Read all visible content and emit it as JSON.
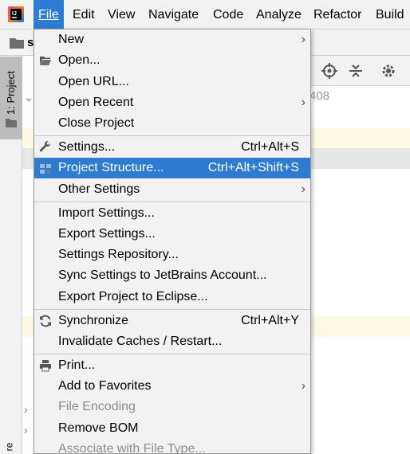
{
  "menubar": {
    "logo_icon": "intellij-idea-icon",
    "items": [
      {
        "label": "File"
      },
      {
        "label": "Edit"
      },
      {
        "label": "View"
      },
      {
        "label": "Navigate"
      },
      {
        "label": "Code"
      },
      {
        "label": "Analyze"
      },
      {
        "label": "Refactor"
      },
      {
        "label": "Build"
      }
    ]
  },
  "background": {
    "breadcrumb_text": "s",
    "project_tab_label": "1: Project",
    "stripe_bottom_label": "re",
    "editor_number": "408"
  },
  "file_menu": {
    "items": [
      {
        "label": "New",
        "has_submenu": true
      },
      {
        "label": "Open...",
        "icon": "folder-open-icon"
      },
      {
        "label": "Open URL..."
      },
      {
        "label": "Open Recent",
        "has_submenu": true
      },
      {
        "label": "Close Project"
      },
      {
        "label": "Settings...",
        "shortcut": "Ctrl+Alt+S",
        "icon": "wrench-icon"
      },
      {
        "label": "Project Structure...",
        "shortcut": "Ctrl+Alt+Shift+S",
        "icon": "project-structure-icon",
        "selected": true
      },
      {
        "label": "Other Settings",
        "has_submenu": true
      },
      {
        "label": "Import Settings..."
      },
      {
        "label": "Export Settings..."
      },
      {
        "label": "Settings Repository..."
      },
      {
        "label": "Sync Settings to JetBrains Account..."
      },
      {
        "label": "Export Project to Eclipse..."
      },
      {
        "label": "Synchronize",
        "shortcut": "Ctrl+Alt+Y",
        "icon": "sync-icon"
      },
      {
        "label": "Invalidate Caches / Restart..."
      },
      {
        "label": "Print...",
        "icon": "printer-icon"
      },
      {
        "label": "Add to Favorites",
        "has_submenu": true
      },
      {
        "label": "File Encoding",
        "disabled": true
      },
      {
        "label": "Remove BOM"
      },
      {
        "label": "Associate with File Type...",
        "disabled": true
      }
    ]
  },
  "colors": {
    "selection": "#2e7cd1",
    "menu_background": "#f2f2f2",
    "disabled_text": "#8c8c8c"
  }
}
